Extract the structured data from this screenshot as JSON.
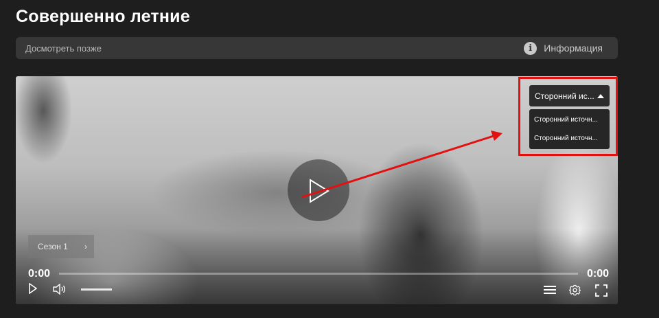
{
  "page": {
    "title": "Совершенно летние"
  },
  "toolbar": {
    "watch_later": "Досмотреть позже",
    "info_label": "Информация"
  },
  "player": {
    "season_label": "Сезон 1",
    "time_current": "0:00",
    "time_total": "0:00",
    "progress": 0,
    "volume": 1,
    "source": {
      "selected": "Сторонний ис...",
      "options": [
        "Сторонний источн...",
        "Сторонний источн..."
      ]
    }
  },
  "annotation": {
    "color": "#e31010"
  }
}
